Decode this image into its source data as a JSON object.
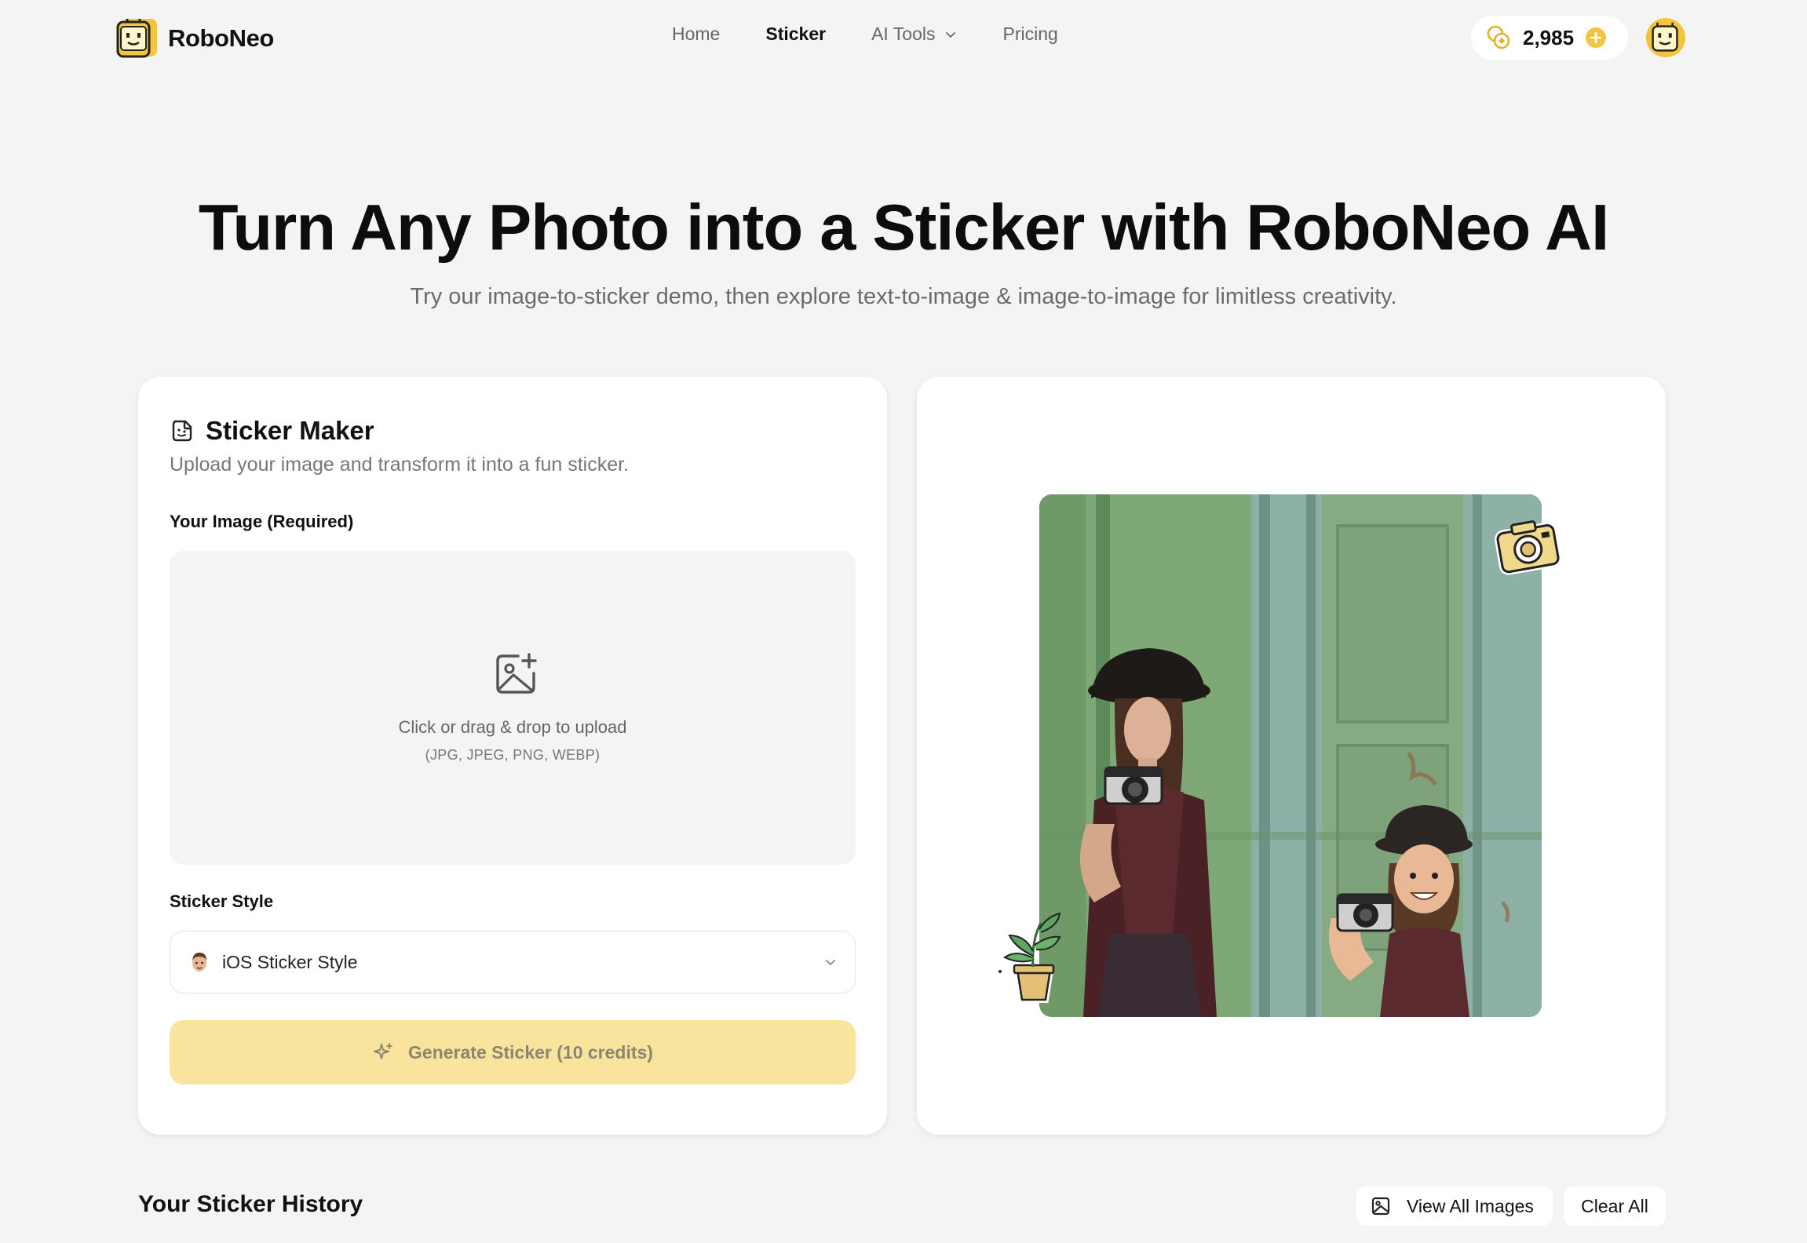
{
  "header": {
    "brand": "RoboNeo",
    "nav": [
      {
        "label": "Home"
      },
      {
        "label": "Sticker"
      },
      {
        "label": "AI Tools"
      },
      {
        "label": "Pricing"
      }
    ],
    "active_nav": "Sticker",
    "credits": "2,985"
  },
  "hero": {
    "title": "Turn Any Photo into a Sticker with RoboNeo AI",
    "subtitle": "Try our image-to-sticker demo, then explore text-to-image & image-to-image for limitless creativity."
  },
  "maker": {
    "title": "Sticker Maker",
    "description": "Upload your image and transform it into a fun sticker.",
    "image_label": "Your Image (Required)",
    "upload_text": "Click or drag & drop to upload",
    "upload_hint": "(JPG, JPEG, PNG, WEBP)",
    "style_label": "Sticker Style",
    "style_value": "iOS Sticker Style",
    "generate_label": "Generate Sticker (10 credits)"
  },
  "history": {
    "title": "Your Sticker History",
    "view_all_label": "View All Images",
    "clear_label": "Clear All"
  },
  "icons": {
    "logo": "robot-face-logo",
    "credits": "coins-icon",
    "add_credits": "plus-circle-icon",
    "upload": "image-plus-icon",
    "sticker": "sticker-icon",
    "generate": "sparkles-icon",
    "view_all": "image-icon"
  },
  "colors": {
    "accent": "#f2c53d",
    "generate_bg": "#f8e49d",
    "page_bg": "#f4f4f4"
  }
}
